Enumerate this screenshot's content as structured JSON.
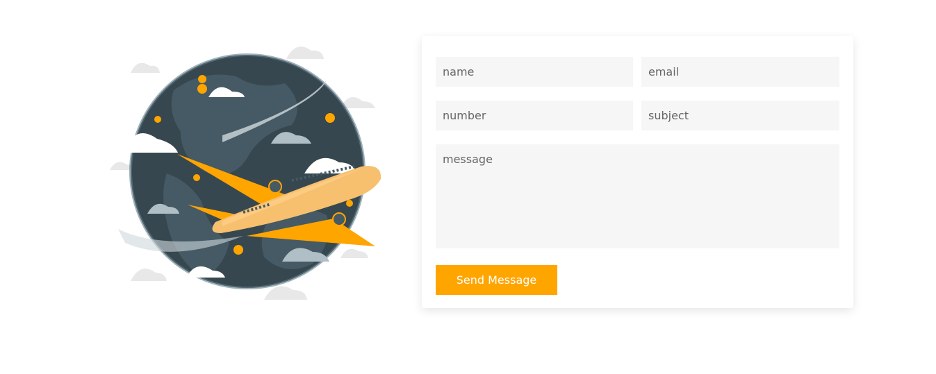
{
  "contact_form": {
    "name_placeholder": "name",
    "email_placeholder": "email",
    "number_placeholder": "number",
    "subject_placeholder": "subject",
    "message_placeholder": "message",
    "send_label": "Send Message"
  },
  "illustration": {
    "icon": "globe-airplane-illustration"
  },
  "colors": {
    "accent": "#ffa500",
    "globe": "#455a64",
    "field_bg": "#f6f6f6"
  }
}
